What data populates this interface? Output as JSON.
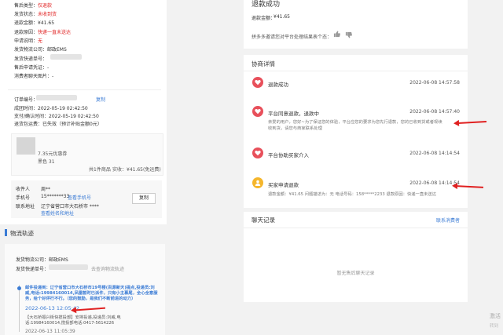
{
  "left": {
    "info_rows": [
      {
        "label": "售后类型：",
        "value": "仅退款"
      },
      {
        "label": "发货状态：",
        "value": "未收到货"
      },
      {
        "label": "退款金额：",
        "value": "¥41.65"
      },
      {
        "label": "退款原因：",
        "value": "快递一直未送达"
      },
      {
        "label": "申请说明：",
        "value": "无"
      },
      {
        "label": "发货物流公司：",
        "value": "邮政EMS"
      },
      {
        "label": "发货快递单号：",
        "value": ""
      },
      {
        "label": "售后申请凭证：",
        "value": "-"
      },
      {
        "label": "消费者聊天图片：",
        "value": "-"
      }
    ],
    "order": {
      "order_no_label": "订单编号：",
      "copy_label": "复制",
      "rows": [
        {
          "label": "成团时间：",
          "value": "2022-05-19 02:42:50"
        },
        {
          "label": "支付/确认时间：",
          "value": "2022-05-19 02:42:50"
        },
        {
          "label": "退货包运费：",
          "value": "已失效（预计补贴金额0元）"
        }
      ]
    },
    "product": {
      "coupon": "7.35元优惠券",
      "spec": "黑色 31",
      "summary": "共1件商品",
      "paid": "实收：¥41.65(免运费)"
    },
    "receiver": {
      "name_label": "收件人",
      "name_value": "周**",
      "phone_label": "手机号",
      "phone_value": "15*******33",
      "phone_link": "查看手机号",
      "addr_label": "联系地址",
      "addr_value": "辽宁省营口市大石桥市 ****",
      "addr_link": "查看姓名和地址",
      "copy_button": "复制"
    },
    "logistics": {
      "title": "物流轨迹",
      "company_label": "发货物流公司：",
      "company_value": "邮政EMS",
      "tracking_label": "发货快递单号：",
      "tracking_link": "去查询物流轨迹",
      "event1": "邮件投递到：辽宁省营口市大石桥市19号楼(百源新天)提点,投递员:刘威,电话:19984160014,凤凰暂时已派件，只有小主慕尾，全心全意服务，给个好评行不行。（您的鼓励，是我们不断前进的动力）",
      "time1": "2022-06-13 12:05:42",
      "event2": "【大石桥振兴街快揽投部】安排投递,投递员:刘威,电话:19984160014,揽投部电话:0417-5614226",
      "time2": "2022-06-13 11:05:39"
    }
  },
  "right": {
    "status": {
      "title": "退款成功",
      "amount_label": "退款金额：",
      "amount_value": "¥41.65",
      "question": "拼多多邀请您对平台处理结果表个态："
    },
    "negotiation": {
      "title": "协商详情",
      "items": [
        {
          "title": "退款成功",
          "time": "2022-06-08 14:57:58",
          "detail": ""
        },
        {
          "title": "平台同意退款，退款中",
          "time": "2022-06-08 14:57:40",
          "detail": "亲爱的用户，您好~为了保证您的体验，平台应您的要求为您先行退款，您的已收到货或者现续收到货，请您与商家联系处理"
        },
        {
          "title": "平台协助买家介入",
          "time": "2022-06-08 14:14:54",
          "detail": ""
        },
        {
          "title": "买家申请退款",
          "time": "2022-06-08 14:14:54",
          "detail": "退款金额：¥41.65 问题描述为：无 电话号码：158*****2233 退款原因：快递一直未送达"
        }
      ]
    },
    "chat": {
      "title": "聊天记录",
      "link": "联系消费者",
      "empty": "暂无售后聊天记录"
    }
  },
  "watermark": {
    "line1": "激活",
    "line2": "转到"
  },
  "colors": {
    "red": "#e02020",
    "blue": "#3a7bd5",
    "avatar_red": "#e8505b",
    "avatar_yellow": "#f5b62c"
  }
}
